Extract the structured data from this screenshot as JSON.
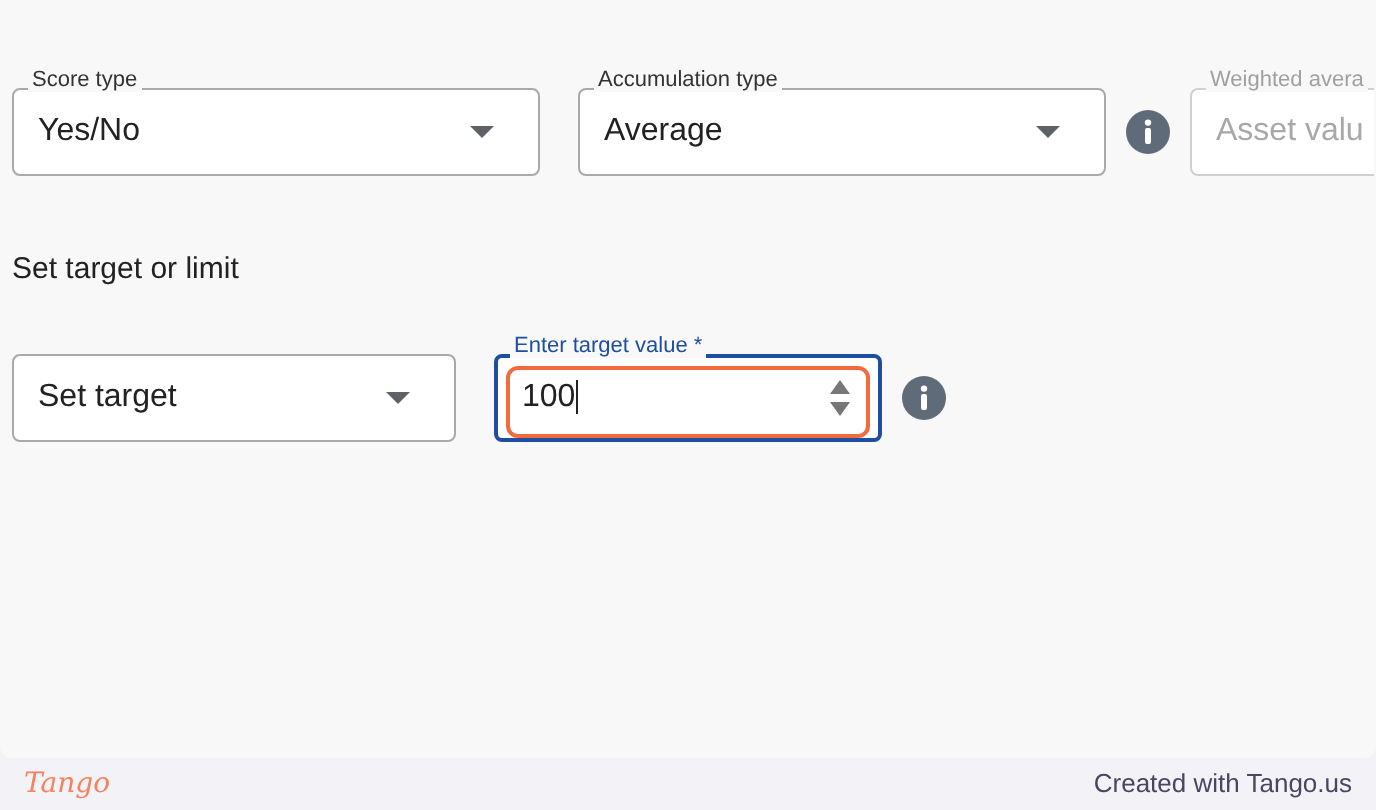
{
  "scoring_fields": [
    {
      "kind": "select",
      "label": "Score type",
      "value": "Yes/No",
      "disabled": false
    },
    {
      "kind": "select",
      "label": "Accumulation type",
      "value": "Average",
      "disabled": false
    },
    {
      "kind": "info"
    },
    {
      "kind": "text",
      "label": "Weighted avera",
      "placeholder": "Asset valu",
      "disabled": true
    }
  ],
  "target_section": {
    "heading": "Set target or limit"
  },
  "target_fields": [
    {
      "kind": "select",
      "value": "Set target",
      "focused": false
    },
    {
      "kind": "number",
      "label": "Enter target value *",
      "value": "100",
      "focused": true,
      "highlighted": true
    },
    {
      "kind": "info"
    }
  ],
  "footer": {
    "logo": "Tango",
    "credit": "Created with Tango.us"
  }
}
